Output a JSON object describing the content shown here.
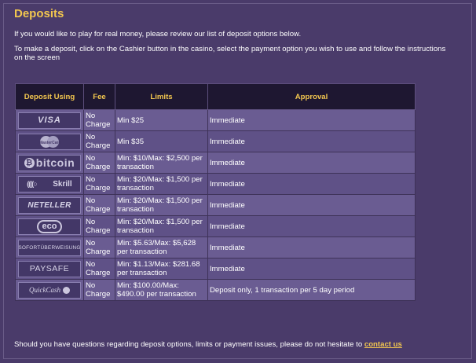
{
  "heading": "Deposits",
  "intro": "If you would like to play for real money, please review our list of deposit options below.",
  "instructions": "To make a deposit, click on the Cashier button in the casino, select the payment option you wish to use and follow the instructions on the screen",
  "table": {
    "headers": [
      "Deposit Using",
      "Fee",
      "Limits",
      "Approval"
    ],
    "rows": [
      {
        "logo_text": "VISA",
        "fee": "No Charge",
        "limits": "Min $25",
        "approval": "Immediate"
      },
      {
        "logo_text": "MasterCard",
        "fee": "No Charge",
        "limits": "Min $35",
        "approval": "Immediate"
      },
      {
        "logo_text": "bitcoin",
        "fee": "No Charge",
        "limits": "Min: $10/Max: $2,500 per transaction",
        "approval": "Immediate"
      },
      {
        "logo_text": "Skrill",
        "fee": "No Charge",
        "limits": "Min: $20/Max: $1,500 per transaction",
        "approval": "Immediate"
      },
      {
        "logo_text": "NETELLER",
        "fee": "No Charge",
        "limits": "Min: $20/Max: $1,500 per transaction",
        "approval": "Immediate"
      },
      {
        "logo_text": "eco",
        "fee": "No Charge",
        "limits": "Min: $20/Max: $1,500 per transaction",
        "approval": "Immediate"
      },
      {
        "logo_text": "SOFORTÜBERWEISUNG",
        "fee": "No Charge",
        "limits": "Min: $5.63/Max: $5,628 per transaction",
        "approval": "Immediate"
      },
      {
        "logo_text": "PAYSAFE",
        "fee": "No Charge",
        "limits": "Min: $1.13/Max: $281.68 per transaction",
        "approval": "Immediate"
      },
      {
        "logo_text": "QuickCash",
        "fee": "No Charge",
        "limits": "Min: $100.00/Max: $490.00 per transaction",
        "approval": "Deposit only, 1 transaction per 5 day period"
      }
    ]
  },
  "footer": {
    "text": "Should you have questions regarding deposit options, limits or payment issues, please do not hesitate to",
    "link": "contact us"
  },
  "colors": {
    "background": "#4a3b6a",
    "accent": "#f2c64f",
    "header_bg": "#1e1731",
    "row_bg": "#6a5c92",
    "row_alt_bg": "#5f5187"
  }
}
